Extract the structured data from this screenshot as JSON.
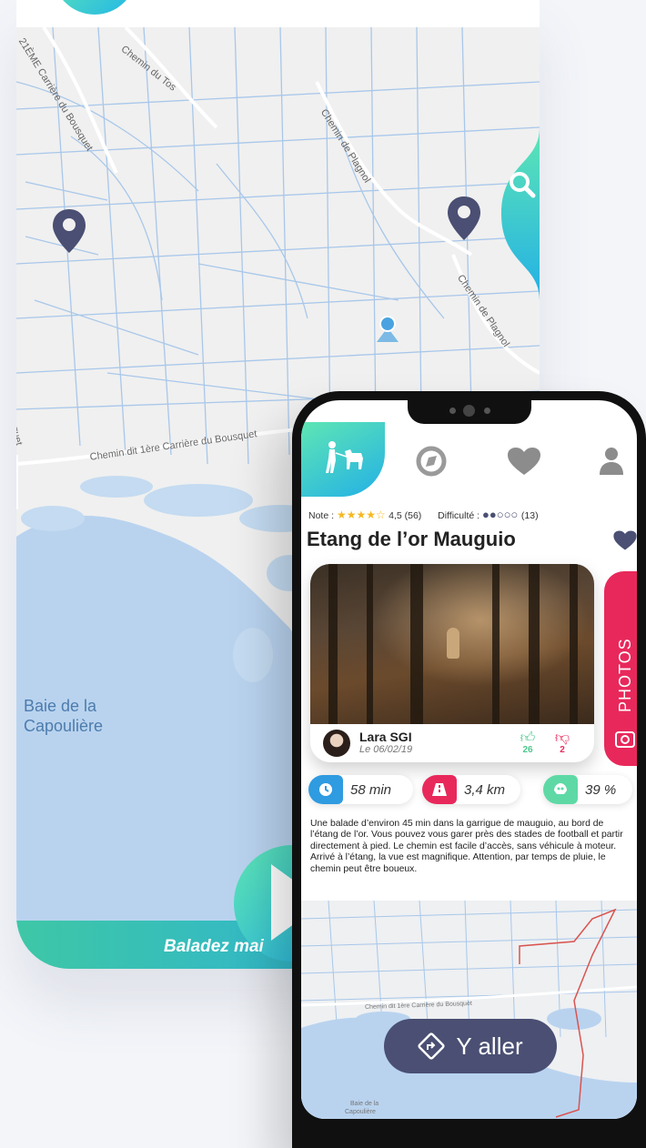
{
  "back_map": {
    "road_labels": [
      "21ÈME Carrière du Bousquet",
      "Chemin du Tos",
      "Chemin de Plagnol",
      "Chemin de Plagnol",
      "Chemin dit 1ère Carrière du Bousquet",
      "usquet"
    ],
    "sea_label_line1": "Baie de la",
    "sea_label_line2": "Capoulière",
    "footer_text": "Baladez mai"
  },
  "nav": {
    "icons": [
      "dog-walk-icon",
      "compass-icon",
      "heart-icon",
      "user-icon"
    ]
  },
  "walk": {
    "note_label": "Note :",
    "rating_stars": 4,
    "rating_text": "4,5 (56)",
    "difficulty_label": "Difficulté :",
    "difficulty_level": 2,
    "difficulty_max": 5,
    "difficulty_count": "(13)",
    "title": "Etang de l’or Mauguio",
    "author_name": "Lara SGI",
    "author_date": "Le 06/02/19",
    "likes": "26",
    "dislikes": "2",
    "photos_tab": "PHOTOS",
    "duration": "58 min",
    "distance": "3,4 km",
    "percent": "39 %",
    "description": "Une balade d’environ 45 min dans la garrigue de mauguio, au bord de l’étang de l’or. Vous pouvez vous garer près des stades de football et partir directement à pied. Le chemin est facile d’accès, sans véhicule à moteur. Arrivé à l’étang, la vue est magnifique. Attention, par temps de pluie, le chemin peut être boueux.",
    "go_button": "Y aller",
    "mini_map_labels": [
      "Chemin dit 1ère Carrière du Bousquet",
      "Baie de la",
      "Capoulière"
    ]
  },
  "colors": {
    "accent_gradient_start": "#5ee6b4",
    "accent_gradient_end": "#23b0e6",
    "pin": "#4a4f73",
    "photos_tab": "#e8285b",
    "star": "#f6b81f",
    "like": "#4cc88d",
    "dislike": "#e8285b",
    "go_button": "#4a4f73"
  }
}
